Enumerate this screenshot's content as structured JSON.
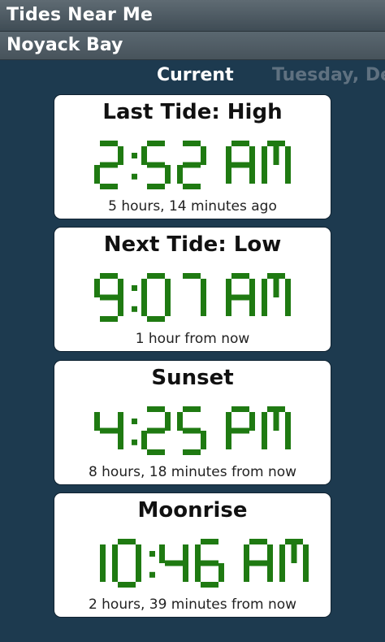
{
  "app": {
    "title": "Tides Near Me",
    "location": "Noyack Bay"
  },
  "tabs": [
    {
      "label": "Current",
      "active": true
    },
    {
      "label": "Tuesday, De",
      "active": false
    }
  ],
  "cards": [
    {
      "title": "Last Tide: High",
      "time": "2:52 AM",
      "relative": "5 hours, 14 minutes ago"
    },
    {
      "title": "Next Tide: Low",
      "time": "9:07 AM",
      "relative": "1 hour from now"
    },
    {
      "title": "Sunset",
      "time": "4:25 PM",
      "relative": "8 hours, 18 minutes from now"
    },
    {
      "title": "Moonrise",
      "time": "10:46 AM",
      "relative": "2 hours, 39 minutes from now"
    }
  ],
  "colors": {
    "digit": "#1f7a12",
    "background": "#1d3a4f",
    "card": "#ffffff"
  }
}
